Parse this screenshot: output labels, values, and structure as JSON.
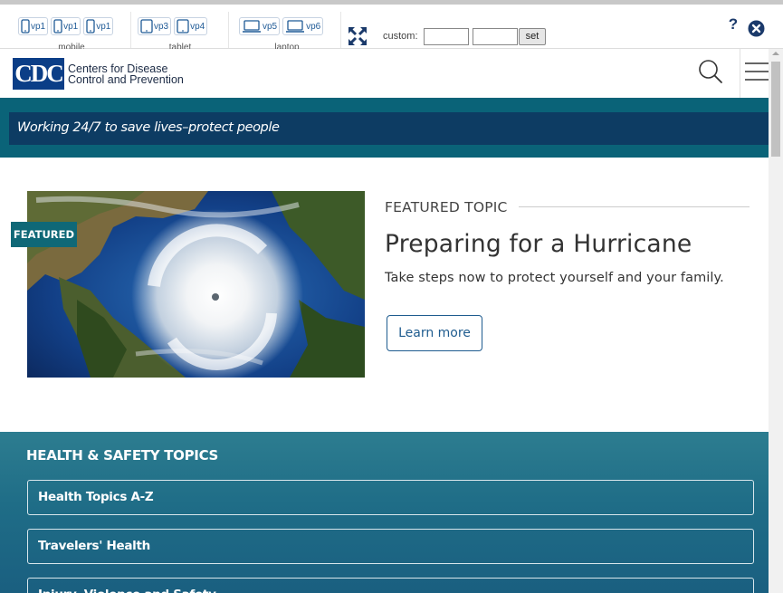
{
  "toolbar": {
    "groups": {
      "mobile": {
        "caption": "mobile",
        "buttons": [
          "vp1",
          "vp1",
          "vp1"
        ]
      },
      "tablet": {
        "caption": "tablet",
        "buttons": [
          "vp3",
          "vp4"
        ]
      },
      "laptop": {
        "caption": "laptop",
        "buttons": [
          "vp5",
          "vp6"
        ]
      }
    },
    "custom_label": "custom:",
    "width_value": "",
    "height_value": "",
    "set_label": "set",
    "help_label": "?",
    "icons": [
      "phone-icon",
      "tablet-icon",
      "laptop-icon",
      "fullscreen-icon",
      "close-circle-icon"
    ]
  },
  "header": {
    "logo_mark": "CDC",
    "agency_line1": "Centers for Disease",
    "agency_line2": "Control and Prevention",
    "icons": [
      "search-icon",
      "hamburger-menu-icon"
    ]
  },
  "tagline": "Working 24/7 to save lives–protect people",
  "featured": {
    "badge": "FEATURED",
    "kicker": "FEATURED TOPIC",
    "title": "Preparing for a Hurricane",
    "description": "Take steps now to protect yourself and your family.",
    "button_label": "Learn more"
  },
  "health_safety": {
    "title": "HEALTH & SAFETY TOPICS",
    "items": [
      "Health Topics A-Z",
      "Travelers' Health",
      "Injury, Violence and Safety"
    ]
  },
  "colors": {
    "cdc_blue": "#0b3e87",
    "tagline_band": "#0a6378",
    "tagline_bar": "#0d3c63",
    "featured_badge": "#0f6877",
    "button_blue": "#1f5c8f",
    "section_teal": "#1f6d87"
  }
}
